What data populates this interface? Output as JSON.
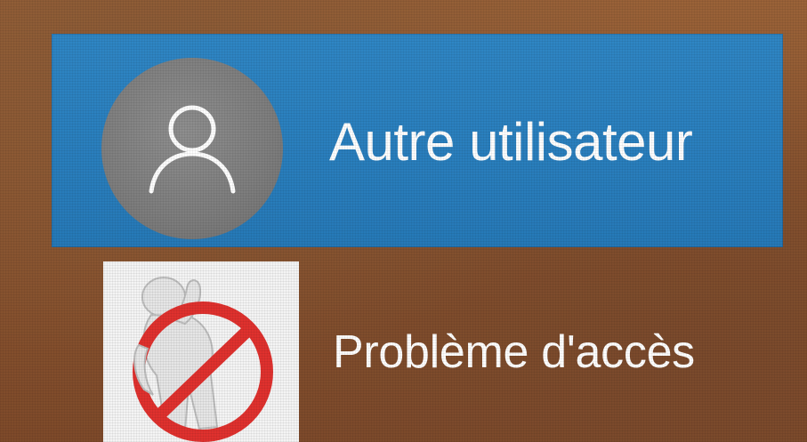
{
  "users": {
    "other_user": {
      "label": "Autre utilisateur",
      "icon": "user-icon",
      "selected": true,
      "accent_color": "#2a7fbe"
    },
    "access_problem": {
      "label": "Problème d'accès",
      "icon": "no-access-icon"
    }
  },
  "colors": {
    "background": "#8b5530",
    "selected_tile": "#2a7fbe",
    "avatar_circle": "#7d7d7d",
    "prohibition_red": "#e0312e"
  }
}
